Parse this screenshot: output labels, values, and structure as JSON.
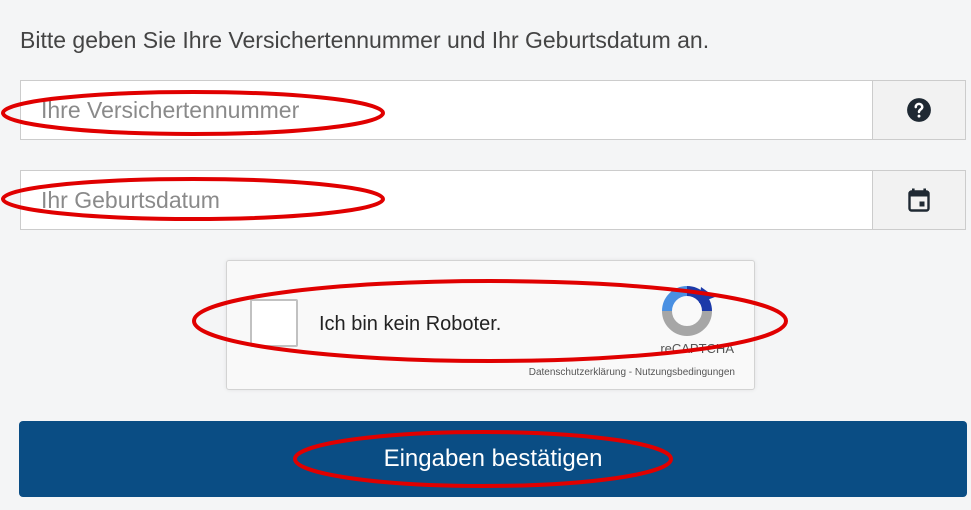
{
  "form": {
    "instruction": "Bitte geben Sie Ihre Versichertennummer und Ihr Geburtsdatum an.",
    "insurance_number": {
      "placeholder": "Ihre Versichertennummer",
      "value": "",
      "addon_icon": "question-circle-icon"
    },
    "birth_date": {
      "placeholder": "Ihr Geburtsdatum",
      "value": "",
      "addon_icon": "calendar-icon"
    },
    "submit_label": "Eingaben bestätigen"
  },
  "recaptcha": {
    "checkbox_label": "Ich bin kein Roboter.",
    "brand": "reCAPTCHA",
    "privacy_link": "Datenschutzerklärung",
    "separator": " - ",
    "terms_link": "Nutzungsbedingungen",
    "checked": false
  },
  "colors": {
    "primary_button": "#0a4d84",
    "annotation_red": "#e00000",
    "icon_dark": "#1f2933"
  }
}
